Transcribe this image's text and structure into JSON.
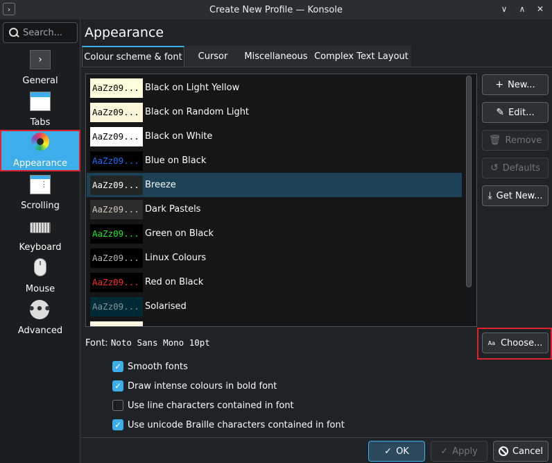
{
  "window": {
    "title": "Create New Profile — Konsole",
    "app_icon": "›",
    "controls": [
      "∨",
      "∧",
      "✕"
    ]
  },
  "sidebar": {
    "search_placeholder": "Search...",
    "items": [
      {
        "label": "General",
        "icon": "general-icon"
      },
      {
        "label": "Tabs",
        "icon": "tabs-icon"
      },
      {
        "label": "Appearance",
        "icon": "appearance-icon"
      },
      {
        "label": "Scrolling",
        "icon": "scrolling-icon"
      },
      {
        "label": "Keyboard",
        "icon": "keyboard-icon"
      },
      {
        "label": "Mouse",
        "icon": "mouse-icon"
      },
      {
        "label": "Advanced",
        "icon": "advanced-icon"
      }
    ]
  },
  "main": {
    "title": "Appearance",
    "tabs": [
      "Colour scheme & font",
      "Cursor",
      "Miscellaneous",
      "Complex Text Layout"
    ],
    "preview_text": "AaZz09...",
    "schemes": [
      {
        "name": "Black on Light Yellow",
        "fg": "#000000",
        "bg": "#ffffdd"
      },
      {
        "name": "Black on Random Light",
        "fg": "#000000",
        "bg": "#fbf5dc"
      },
      {
        "name": "Black on White",
        "fg": "#000000",
        "bg": "#ffffff"
      },
      {
        "name": "Blue on Black",
        "fg": "#1c6cff",
        "bg": "#000000"
      },
      {
        "name": "Breeze",
        "fg": "#fcfcfc",
        "bg": "#232627"
      },
      {
        "name": "Dark Pastels",
        "fg": "#cfc8b8",
        "bg": "#2c2c2c"
      },
      {
        "name": "Green on Black",
        "fg": "#18f018",
        "bg": "#000000"
      },
      {
        "name": "Linux Colours",
        "fg": "#b2b2b2",
        "bg": "#000000"
      },
      {
        "name": "Red on Black",
        "fg": "#ff2b2b",
        "bg": "#000000"
      },
      {
        "name": "Solarised",
        "fg": "#839496",
        "bg": "#002b36"
      },
      {
        "name": "",
        "fg": "#000000",
        "bg": "#fdf6e3"
      }
    ],
    "buttons": {
      "new": "New...",
      "edit": "Edit...",
      "remove": "Remove",
      "defaults": "Defaults",
      "get_new": "Get New..."
    },
    "font_label": "Font:",
    "font_value": "Noto Sans Mono 10pt",
    "choose_label": "Choose...",
    "choose_icon_text": "Aa",
    "checkboxes": [
      {
        "label": "Smooth fonts",
        "checked": true
      },
      {
        "label": "Draw intense colours in bold font",
        "checked": true
      },
      {
        "label": "Use line characters contained in font",
        "checked": false
      },
      {
        "label": "Use unicode Braille characters contained in font",
        "checked": true
      }
    ]
  },
  "footer": {
    "ok": "OK",
    "apply": "Apply",
    "cancel": "Cancel"
  },
  "colors": {
    "accent": "#3daee9",
    "highlight": "#e0202a",
    "selection": "#1d4257"
  }
}
